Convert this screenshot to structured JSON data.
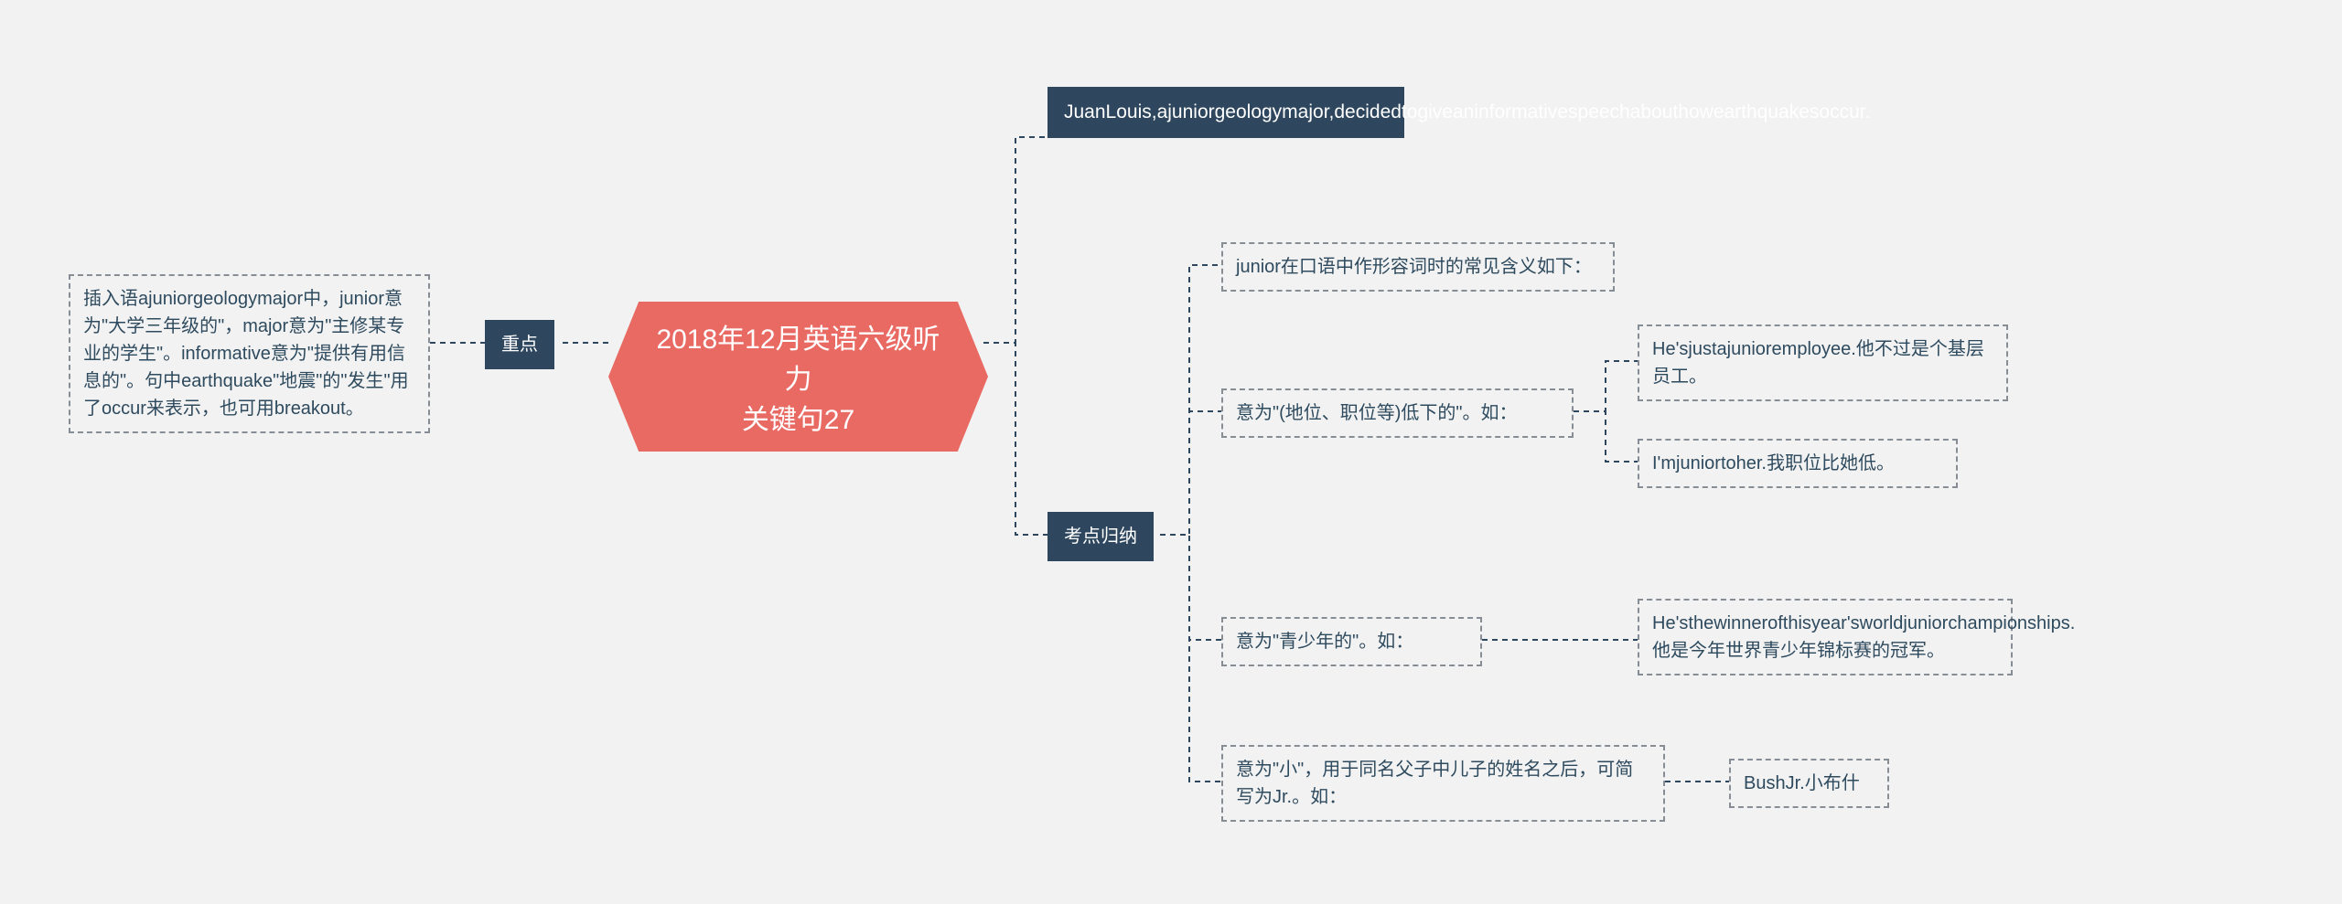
{
  "root": {
    "title_line1": "2018年12月英语六级听力",
    "title_line2": "关键句27"
  },
  "left": {
    "key_label": "重点",
    "key_text": "插入语ajuniorgeologymajor中，junior意为\"大学三年级的\"，major意为\"主修某专业的学生\"。informative意为\"提供有用信息的\"。句中earthquake\"地震\"的\"发生\"用了occur来表示，也可用breakout。"
  },
  "right": {
    "sentence": "JuanLouis,ajuniorgeologymajor,decidedtogiveaninformativespeechabouthowearthquakesoccur.",
    "exam_label": "考点归纳",
    "intro": "junior在口语中作形容词时的常见含义如下：",
    "meaning1": {
      "label": "意为\"(地位、职位等)低下的\"。如：",
      "ex1": "He'sjustajunioremployee.他不过是个基层员工。",
      "ex2": "I'mjuniortoher.我职位比她低。"
    },
    "meaning2": {
      "label": "意为\"青少年的\"。如：",
      "ex1": "He'sthewinnerofthisyear'sworldjuniorchampionships.他是今年世界青少年锦标赛的冠军。"
    },
    "meaning3": {
      "label": "意为\"小\"，用于同名父子中儿子的姓名之后，可简写为Jr.。如：",
      "ex1": "BushJr.小布什"
    }
  }
}
